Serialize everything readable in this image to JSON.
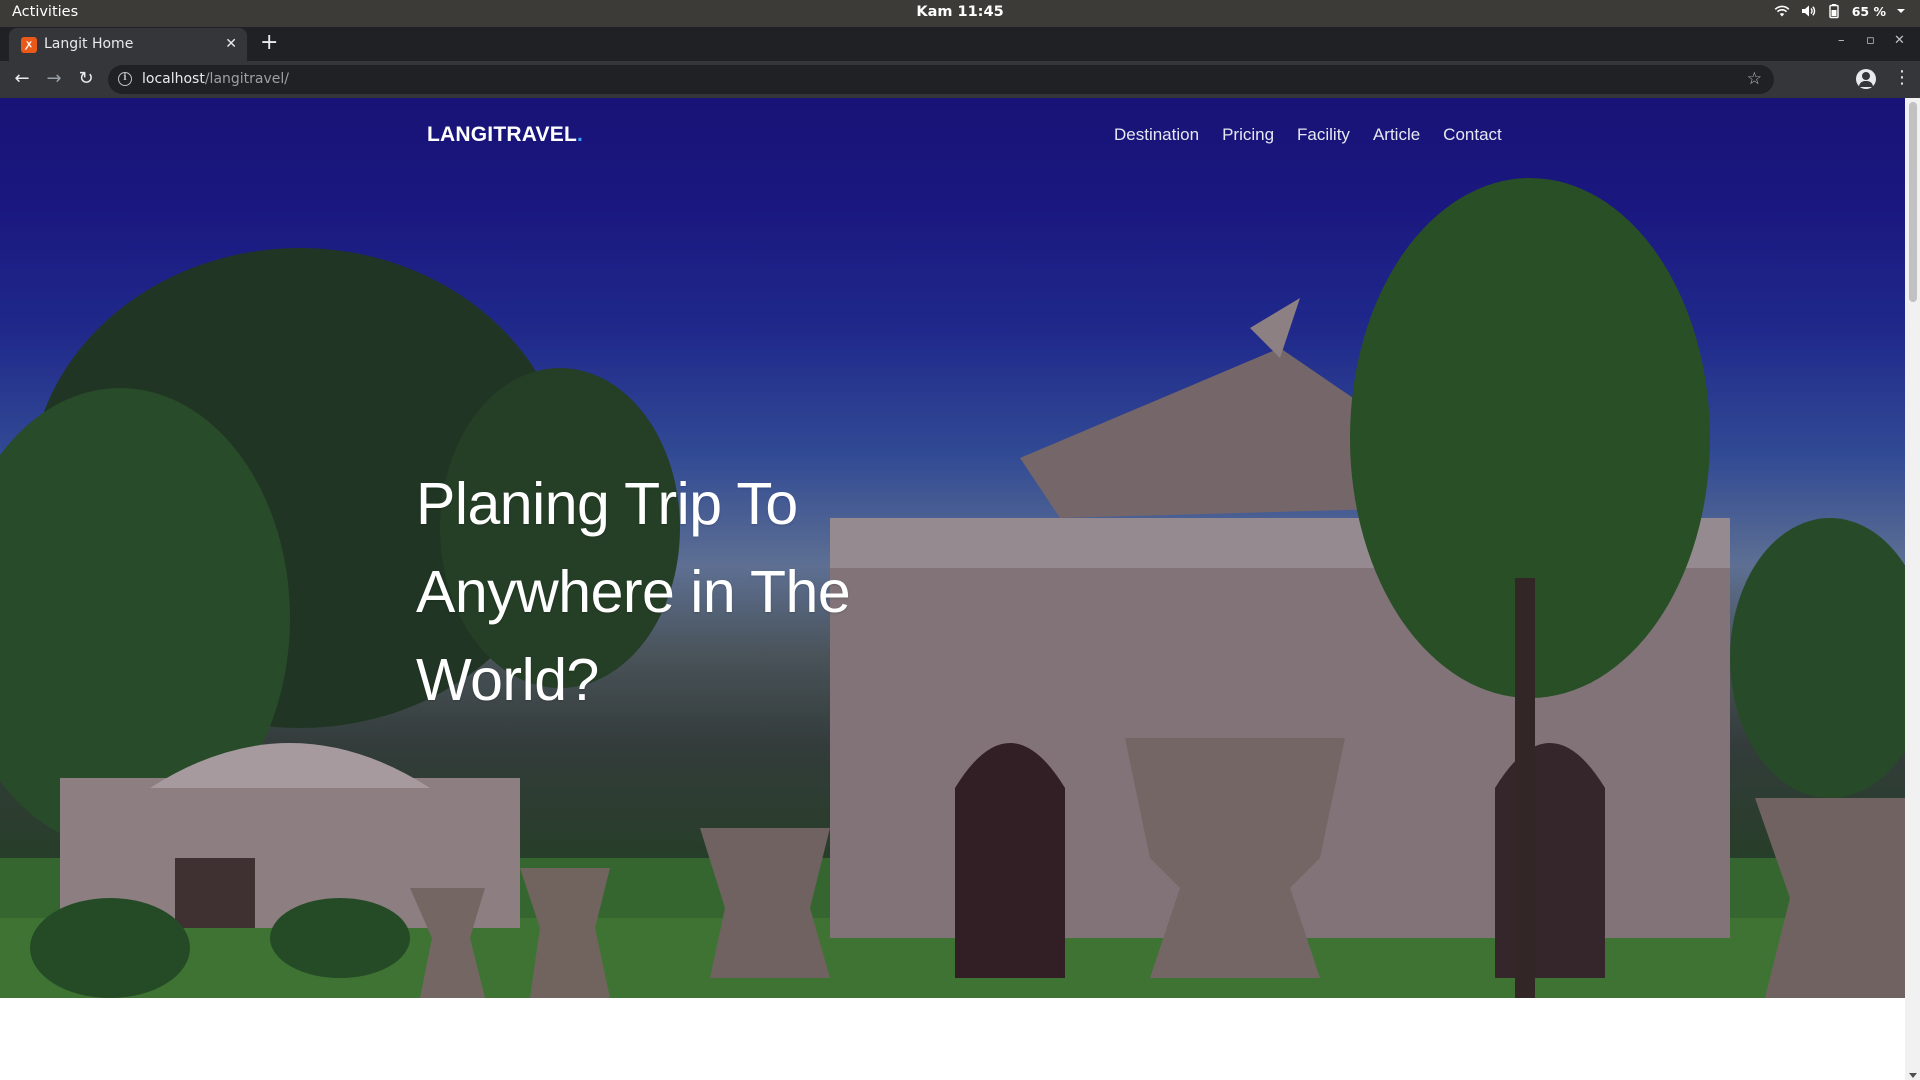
{
  "os_bar": {
    "activities": "Activities",
    "clock": "Kam 11:45",
    "battery": "65 %"
  },
  "browser": {
    "tab_title": "Langit Home",
    "favicon": "xampp-icon",
    "new_tab": "+",
    "url_host": "localhost",
    "url_path": "/langitravel/"
  },
  "site": {
    "brand": "LANGITRAVEL",
    "brand_dot": ".",
    "nav": [
      "Destination",
      "Pricing",
      "Facility",
      "Article",
      "Contact"
    ],
    "headline": "Planing Trip To Anywhere in The World?"
  },
  "colors": {
    "hero_sky": "#1a1583",
    "brand_dot": "#2fa3ff",
    "topbar": "#3c3b37",
    "tab_strip": "#202124"
  }
}
